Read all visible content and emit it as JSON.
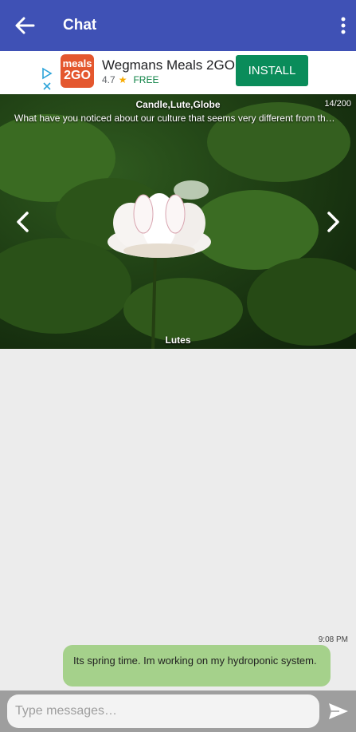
{
  "appbar": {
    "title": "Chat",
    "back_icon": "arrow-left-icon",
    "more_icon": "more-vertical-icon",
    "color": "#3f51b5"
  },
  "ad": {
    "logo_line1": "meals",
    "logo_line2": "2GO",
    "app_name": "Wegmans Meals 2GO",
    "rating": "4.7",
    "price": "FREE",
    "install_label": "INSTALL",
    "install_color": "#0a8c5a"
  },
  "hero": {
    "tags": "Candle,Lute,Globe",
    "counter": "14/200",
    "question": "What have you noticed about our culture that seems very different from  th…",
    "caption": "Lutes"
  },
  "messages": [
    {
      "time": "9:08 PM",
      "text": "Its spring time.  Im working on my hydroponic system.",
      "color": "#a5d18b"
    }
  ],
  "composer": {
    "placeholder": "Type messages…",
    "send_icon": "send-icon"
  }
}
